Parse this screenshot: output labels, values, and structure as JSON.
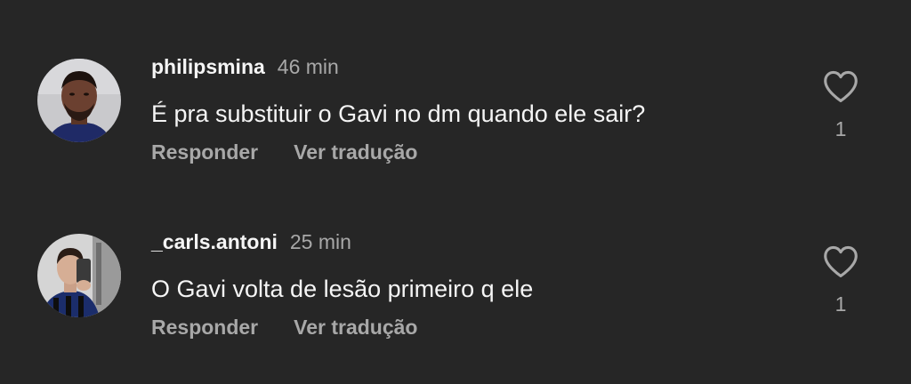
{
  "comments": [
    {
      "username": "philipsmina",
      "time": "46 min",
      "text": "É pra substituir o Gavi no dm quando ele sair?",
      "reply_label": "Responder",
      "translate_label": "Ver tradução",
      "like_icon": "heart-outline-icon",
      "like_count": "1"
    },
    {
      "username": "_carls.antoni",
      "time": "25 min",
      "text": "O Gavi volta de lesão primeiro q ele",
      "reply_label": "Responder",
      "translate_label": "Ver tradução",
      "like_icon": "heart-outline-icon",
      "like_count": "1"
    }
  ],
  "colors": {
    "background": "#262626",
    "primary_text": "#f5f5f5",
    "secondary_text": "#a8a8a8"
  }
}
